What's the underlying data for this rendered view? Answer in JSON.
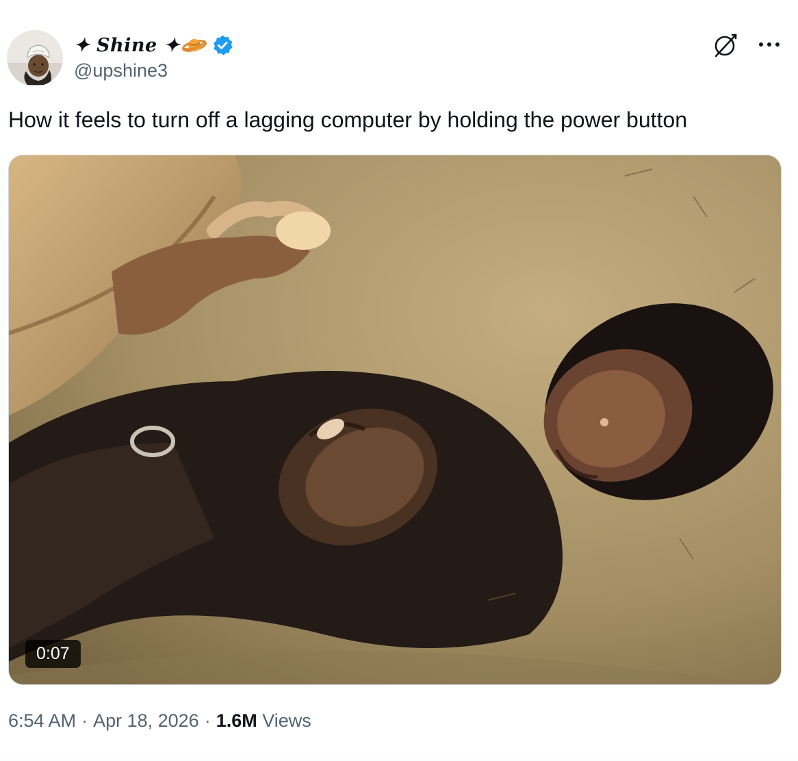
{
  "author": {
    "display_name": "✦ Shine ✦",
    "handle": "@upshine3",
    "verified": true,
    "badge_color": "#1d9bf0",
    "name_emoji": "ringed-planet-emoji"
  },
  "tweet": {
    "text": "How it feels to turn off a lagging computer by holding the power button"
  },
  "media": {
    "type": "video",
    "duration": "0:07"
  },
  "meta": {
    "time": "6:54 AM",
    "separator": "·",
    "date": "Apr 18, 2026",
    "views_count": "1.6M",
    "views_label": "Views"
  },
  "icons": {
    "grok": "grok-icon",
    "more": "more-icon",
    "verified": "verified-badge-icon"
  },
  "colors": {
    "text_primary": "#0f1419",
    "text_secondary": "#536471",
    "accent": "#1d9bf0",
    "border": "#cfd9de"
  }
}
